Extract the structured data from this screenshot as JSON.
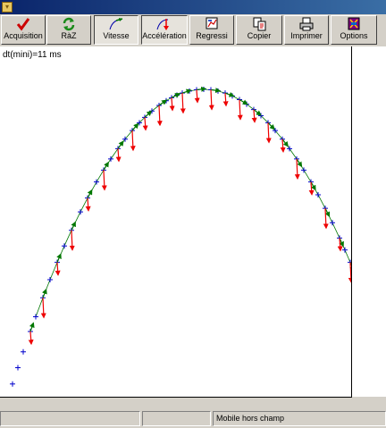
{
  "toolbar": {
    "buttons": [
      {
        "label": "Acquisition",
        "icon": "checkmark-icon"
      },
      {
        "label": "RàZ",
        "icon": "refresh-arrows-icon"
      },
      {
        "label": "Vitesse",
        "icon": "velocity-curve-icon"
      },
      {
        "label": "Accélération",
        "icon": "acceleration-curve-icon"
      },
      {
        "label": "Regressi",
        "icon": "regressi-icon"
      },
      {
        "label": "Copier",
        "icon": "copy-icon"
      },
      {
        "label": "Imprimer",
        "icon": "printer-icon"
      },
      {
        "label": "Options",
        "icon": "options-icon"
      }
    ]
  },
  "plot": {
    "dt_label": "dt(mini)=11 ms",
    "colors": {
      "points": "#0000cc",
      "velocity": "#007700",
      "acceleration": "#ee0000"
    }
  },
  "statusbar": {
    "message": "Mobile hors champ"
  }
}
